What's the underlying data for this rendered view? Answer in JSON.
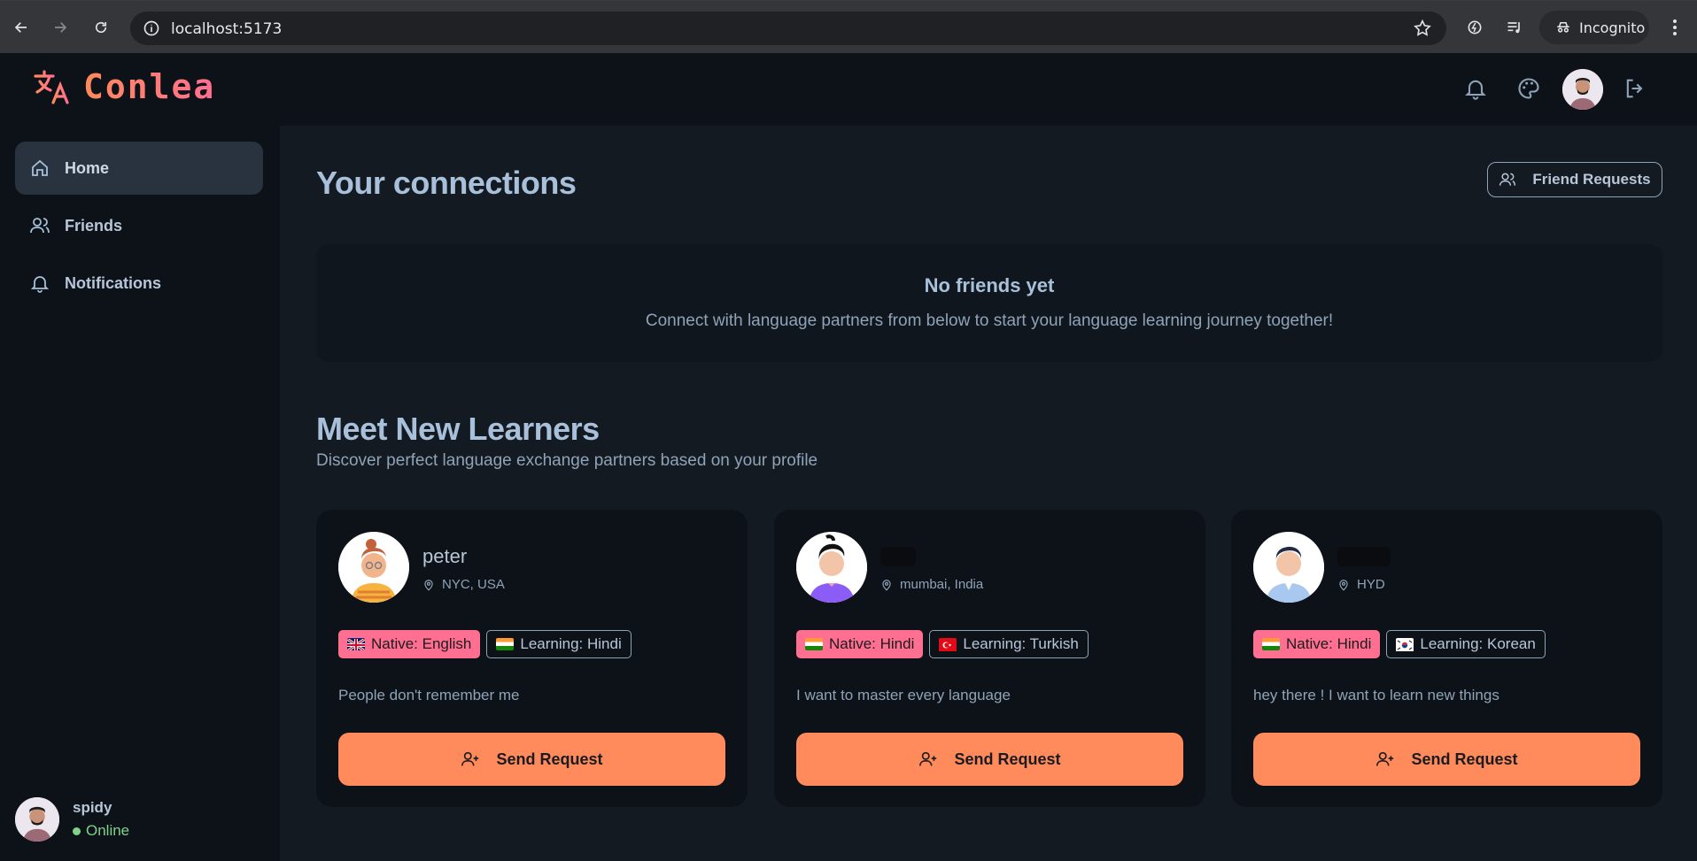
{
  "browser": {
    "url": "localhost:5173",
    "incognito_label": "Incognito"
  },
  "app": {
    "logo_text": "Conlea",
    "accent": "#ff8a5b",
    "accent_pink": "#ff6f91"
  },
  "sidebar": {
    "items": [
      {
        "label": "Home",
        "icon": "home-icon",
        "active": true
      },
      {
        "label": "Friends",
        "icon": "users-icon",
        "active": false
      },
      {
        "label": "Notifications",
        "icon": "bell-icon",
        "active": false
      }
    ],
    "user": {
      "name": "spidy",
      "status": "Online"
    }
  },
  "main": {
    "connections_title": "Your connections",
    "friend_requests_label": "Friend Requests",
    "empty_title": "No friends yet",
    "empty_desc": "Connect with language partners from below to start your language learning journey together!",
    "learners_title": "Meet New Learners",
    "learners_subtitle": "Discover perfect language exchange partners based on your profile",
    "send_label": "Send Request",
    "cards": [
      {
        "name": "peter",
        "location": "NYC, USA",
        "native": "Native: English",
        "learning": "Learning: Hindi",
        "native_flag": "uk-flag",
        "learning_flag": "india-flag",
        "bio": "People don't remember me"
      },
      {
        "name": "",
        "location": "mumbai, India",
        "native": "Native: Hindi",
        "learning": "Learning: Turkish",
        "native_flag": "india-flag",
        "learning_flag": "turkey-flag",
        "bio": "I want to master every language"
      },
      {
        "name": "",
        "location": "HYD",
        "native": "Native: Hindi",
        "learning": "Learning: Korean",
        "native_flag": "india-flag",
        "learning_flag": "korea-flag",
        "bio": "hey there ! I want to learn new things"
      }
    ]
  }
}
